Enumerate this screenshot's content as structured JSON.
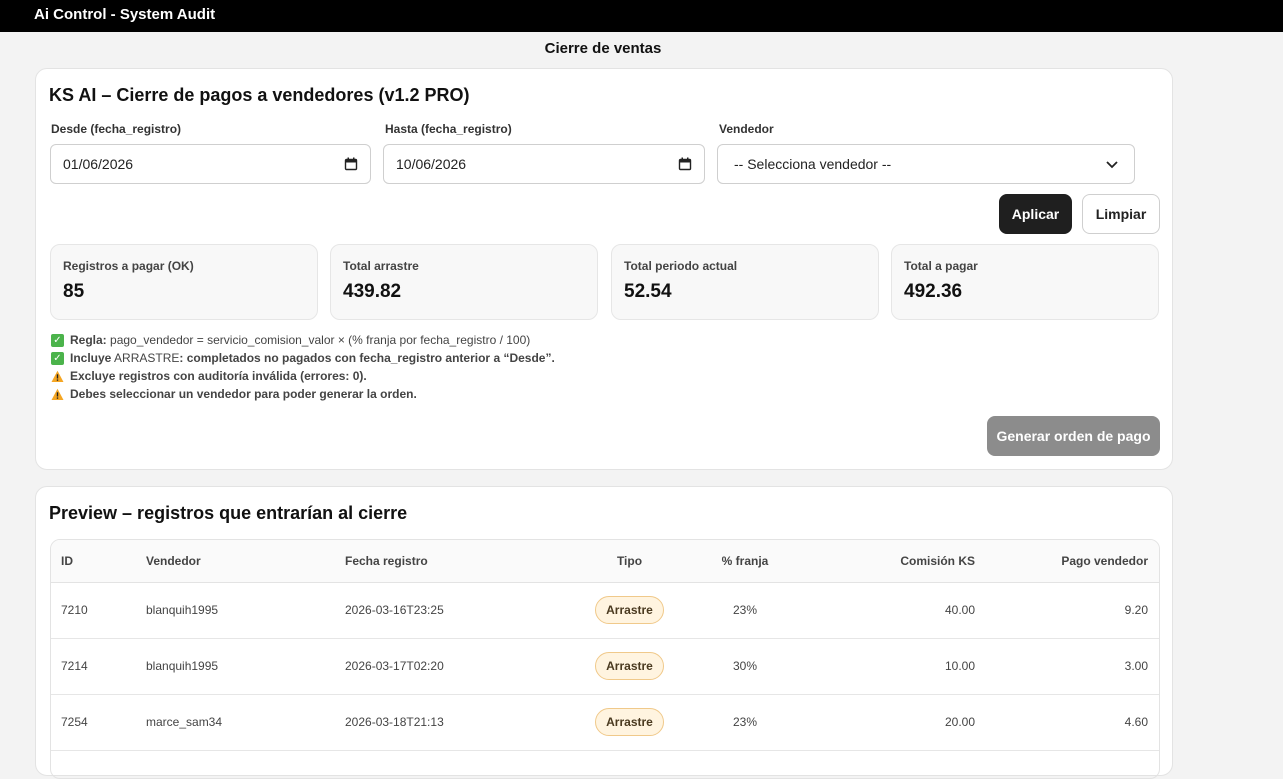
{
  "app": {
    "title": "Ai Control - System Audit"
  },
  "page": {
    "title": "Cierre de ventas"
  },
  "cierre": {
    "title": "KS AI – Cierre de pagos a vendedores (v1.2 PRO)",
    "desde_label": "Desde (fecha_registro)",
    "desde_value": "01/06/2026",
    "hasta_label": "Hasta (fecha_registro)",
    "hasta_value": "10/06/2026",
    "vendedor_label": "Vendedor",
    "vendedor_selected": "-- Selecciona vendedor --",
    "apply_label": "Aplicar",
    "clear_label": "Limpiar",
    "stats": [
      {
        "label": "Registros a pagar (OK)",
        "value": "85"
      },
      {
        "label": "Total arrastre",
        "value": "439.82"
      },
      {
        "label": "Total periodo actual",
        "value": "52.54"
      },
      {
        "label": "Total a pagar",
        "value": "492.36"
      }
    ],
    "notes": {
      "n1_bold": "Regla:",
      "n1_text": " pago_vendedor = servicio_comision_valor × (% franja por fecha_registro / 100)",
      "n2_bold": "Incluye",
      "n2_text": " ARRASTRE",
      "n2_rest": ": completados no pagados con fecha_registro anterior a “Desde”.",
      "n3_text": "Excluye registros con auditoría inválida (errores: 0).",
      "n4_text": "Debes seleccionar un vendedor para poder generar la orden."
    },
    "generate_label": "Generar orden de pago"
  },
  "preview": {
    "title": "Preview – registros que entrarían al cierre",
    "columns": {
      "id": "ID",
      "vendedor": "Vendedor",
      "fecha": "Fecha registro",
      "tipo": "Tipo",
      "franja": "% franja",
      "comision": "Comisión KS",
      "pago": "Pago vendedor"
    },
    "rows": [
      {
        "id": "7210",
        "vendedor": "blanquih1995",
        "fecha": "2026-03-16T23:25",
        "tipo": "Arrastre",
        "franja": "23%",
        "comision": "40.00",
        "pago": "9.20"
      },
      {
        "id": "7214",
        "vendedor": "blanquih1995",
        "fecha": "2026-03-17T02:20",
        "tipo": "Arrastre",
        "franja": "30%",
        "comision": "10.00",
        "pago": "3.00"
      },
      {
        "id": "7254",
        "vendedor": "marce_sam34",
        "fecha": "2026-03-18T21:13",
        "tipo": "Arrastre",
        "franja": "23%",
        "comision": "20.00",
        "pago": "4.60"
      }
    ]
  },
  "colors": {
    "topbar": "#000000",
    "badge_bg": "#fff4e0",
    "badge_border": "#f0c98a",
    "check": "#4bb34b",
    "warn": "#f5a623"
  }
}
